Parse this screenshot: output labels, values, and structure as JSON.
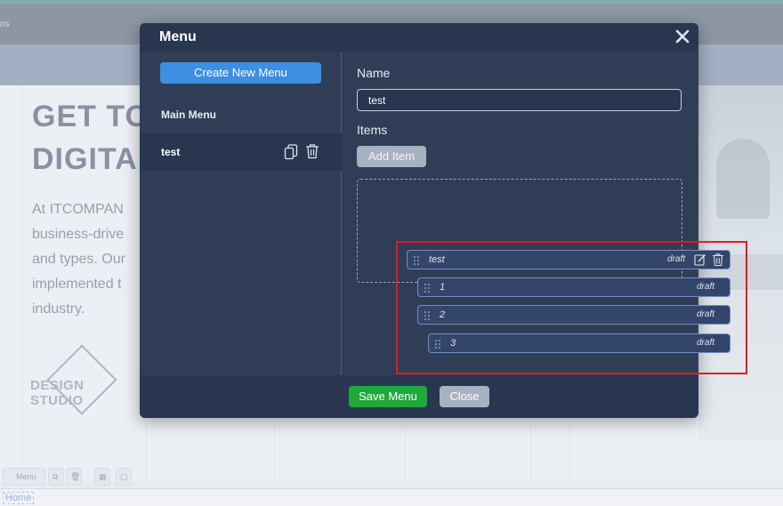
{
  "background": {
    "topbar_tab": "ns",
    "heading_line1": "GET TO",
    "heading_line2": "DIGITAL",
    "paragraph_lines": [
      "At ITCOMPAN",
      "business-drive",
      "and types. Our",
      "implemented t",
      "industry."
    ],
    "logo_text": "DESIGN STUDIO",
    "toolbar": {
      "menu_label": "Menu"
    },
    "breadcrumb": "Home"
  },
  "modal": {
    "title": "Menu",
    "sidebar": {
      "create_button": "Create New Menu",
      "section_label": "Main Menu",
      "menus": [
        {
          "label": "test"
        }
      ]
    },
    "form": {
      "name_label": "Name",
      "name_value": "test",
      "items_label": "Items",
      "add_item_button": "Add Item"
    },
    "footer": {
      "save_button": "Save Menu",
      "close_button": "Close"
    }
  },
  "items": [
    {
      "label": "test",
      "status": "draft"
    },
    {
      "label": "1",
      "status": "draft"
    },
    {
      "label": "2",
      "status": "draft"
    },
    {
      "label": "3",
      "status": "draft"
    }
  ],
  "colors": {
    "modal_bg": "#2f3d57",
    "primary": "#3c8fe3",
    "success": "#1ea93a",
    "secondary": "#a8b1bf",
    "highlight": "#e21b23"
  }
}
